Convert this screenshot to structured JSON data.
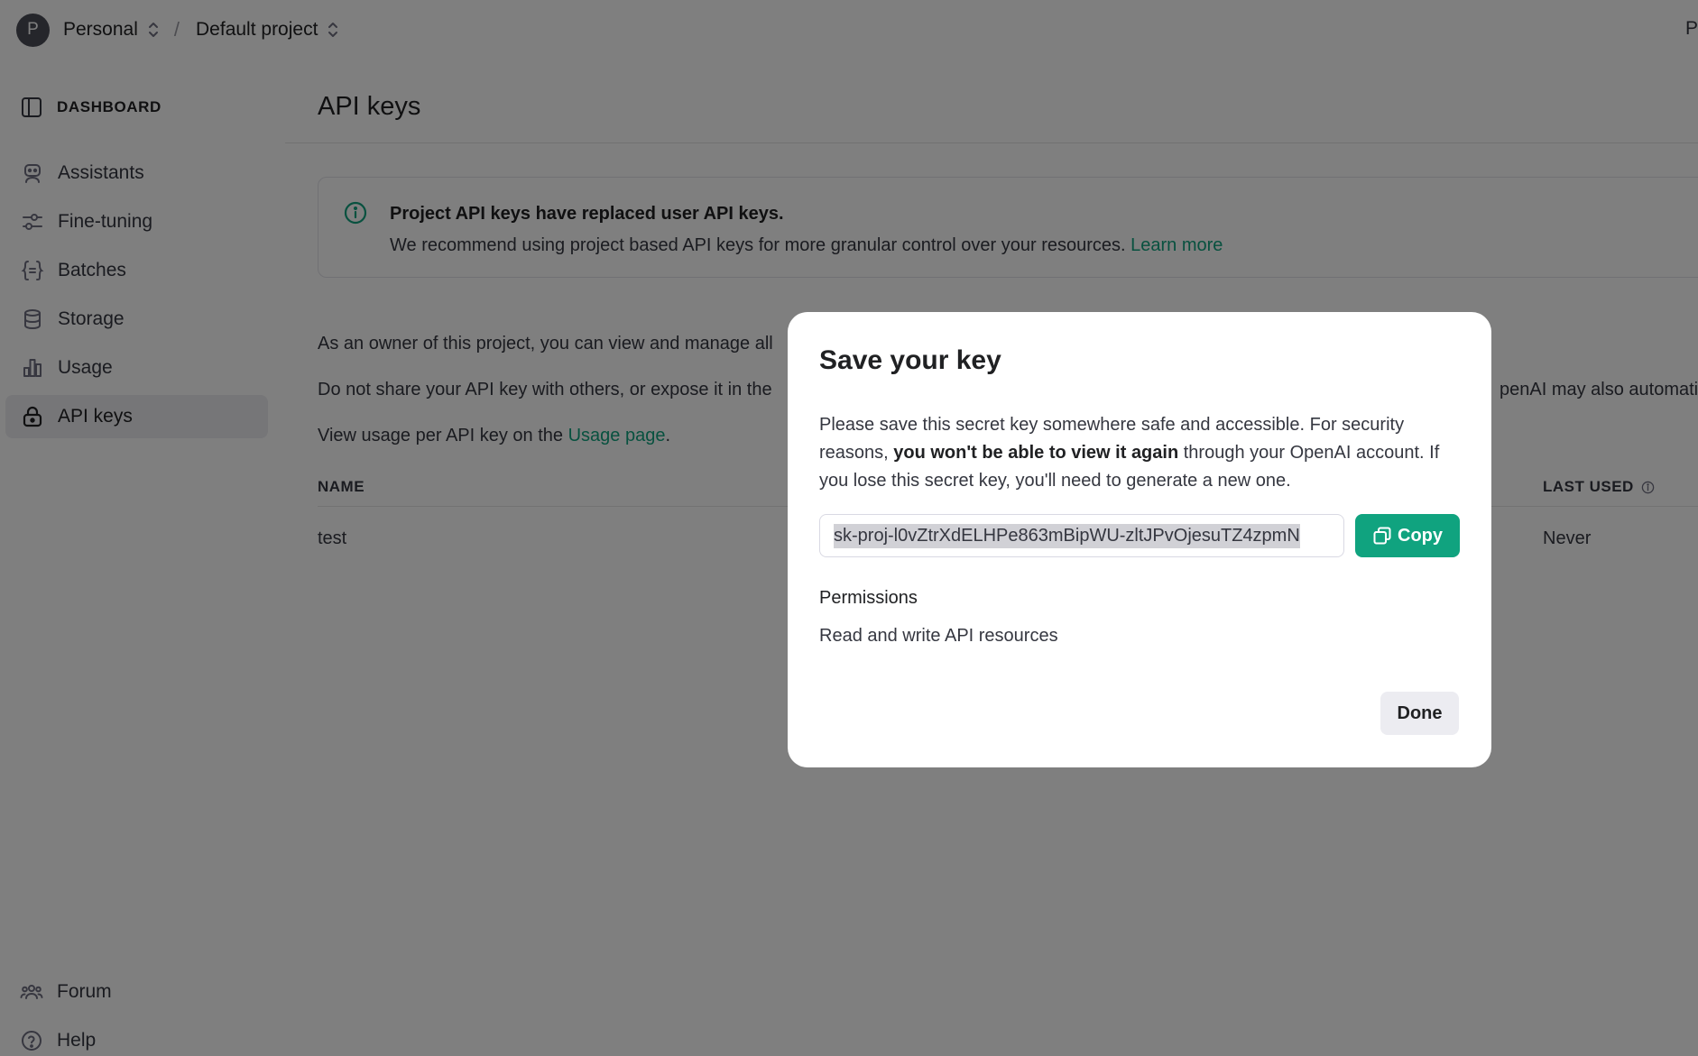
{
  "header": {
    "avatar_initial": "P",
    "org_name": "Personal",
    "separator": "/",
    "project_name": "Default project",
    "right_text": "P"
  },
  "sidebar": {
    "heading": "DASHBOARD",
    "items": [
      {
        "label": "Assistants",
        "icon": "robot-icon"
      },
      {
        "label": "Fine-tuning",
        "icon": "sliders-icon"
      },
      {
        "label": "Batches",
        "icon": "braces-icon"
      },
      {
        "label": "Storage",
        "icon": "database-icon"
      },
      {
        "label": "Usage",
        "icon": "bar-chart-icon"
      },
      {
        "label": "API keys",
        "icon": "lock-icon",
        "active": true
      }
    ],
    "bottom": [
      {
        "label": "Forum",
        "icon": "people-icon"
      },
      {
        "label": "Help",
        "icon": "help-icon"
      }
    ]
  },
  "main": {
    "title": "API keys",
    "notice": {
      "heading": "Project API keys have replaced user API keys.",
      "body": "We recommend using project based API keys for more granular control over your resources. ",
      "link": "Learn more"
    },
    "para1": "As an owner of this project, you can view and manage all",
    "para2_left": "Do not share your API key with others, or expose it in the",
    "para2_right": "penAI may also automatic",
    "para3_prefix": "View usage per API key on the ",
    "para3_link": "Usage page",
    "para3_suffix": ".",
    "table": {
      "col_name": "NAME",
      "col_last_used": "LAST USED",
      "rows": [
        {
          "name": "test",
          "last_used": "Never"
        }
      ]
    }
  },
  "modal": {
    "title": "Save your key",
    "text_1": "Please save this secret key somewhere safe and accessible. For security reasons, ",
    "text_bold": "you won't be able to view it again",
    "text_2": " through your OpenAI account. If you lose this secret key, you'll need to generate a new one.",
    "key_value": "sk-proj-l0vZtrXdELHPe863mBipWU-zltJPvOjesuTZ4zpmN",
    "copy_label": "Copy",
    "permissions_heading": "Permissions",
    "permissions_value": "Read and write API resources",
    "done_label": "Done"
  },
  "colors": {
    "accent": "#10a37f",
    "overlay": "rgba(0,0,0,0.5)"
  }
}
